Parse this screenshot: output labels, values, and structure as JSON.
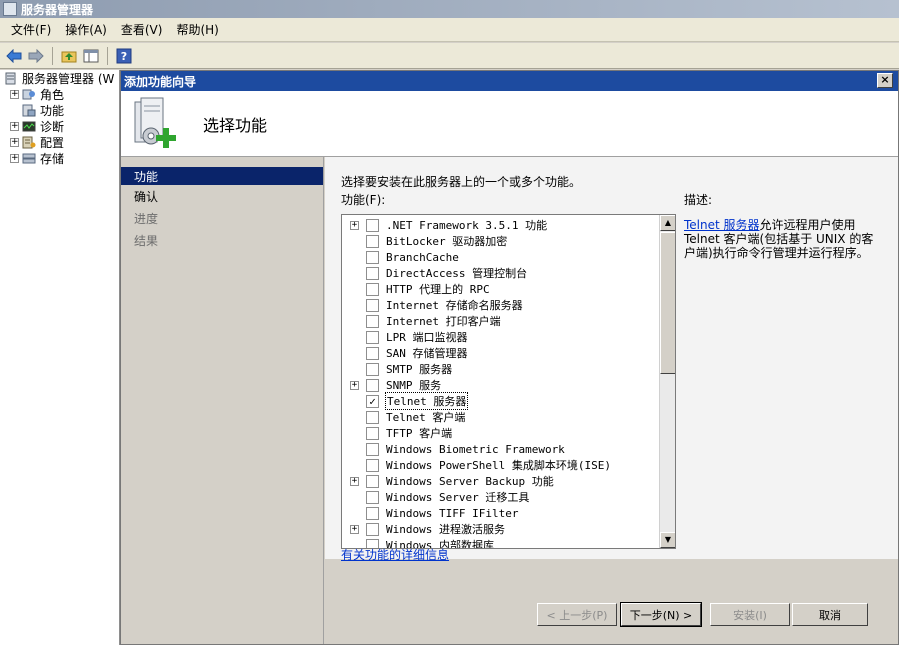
{
  "window": {
    "title": "服务器管理器"
  },
  "menu": [
    "文件(F)",
    "操作(A)",
    "查看(V)",
    "帮助(H)"
  ],
  "tree": {
    "root": "服务器管理器 (W",
    "items": [
      {
        "label": "角色",
        "expandable": true
      },
      {
        "label": "功能",
        "expandable": false
      },
      {
        "label": "诊断",
        "expandable": true
      },
      {
        "label": "配置",
        "expandable": true
      },
      {
        "label": "存储",
        "expandable": true
      }
    ]
  },
  "dialog": {
    "title": "添加功能向导",
    "close": "×",
    "header_title": "选择功能",
    "steps": [
      {
        "label": "功能",
        "state": "active"
      },
      {
        "label": "确认",
        "state": "normal"
      },
      {
        "label": "进度",
        "state": "disabled"
      },
      {
        "label": "结果",
        "state": "disabled"
      }
    ],
    "intro": "选择要安装在此服务器上的一个或多个功能。",
    "features_label": "功能(F):",
    "features": [
      {
        "label": ".NET Framework 3.5.1 功能",
        "expandable": true,
        "checked": false
      },
      {
        "label": "BitLocker 驱动器加密",
        "expandable": false,
        "checked": false
      },
      {
        "label": "BranchCache",
        "expandable": false,
        "checked": false
      },
      {
        "label": "DirectAccess 管理控制台",
        "expandable": false,
        "checked": false
      },
      {
        "label": "HTTP 代理上的 RPC",
        "expandable": false,
        "checked": false
      },
      {
        "label": "Internet 存储命名服务器",
        "expandable": false,
        "checked": false
      },
      {
        "label": "Internet 打印客户端",
        "expandable": false,
        "checked": false
      },
      {
        "label": "LPR 端口监视器",
        "expandable": false,
        "checked": false
      },
      {
        "label": "SAN 存储管理器",
        "expandable": false,
        "checked": false
      },
      {
        "label": "SMTP 服务器",
        "expandable": false,
        "checked": false
      },
      {
        "label": "SNMP 服务",
        "expandable": true,
        "checked": false
      },
      {
        "label": "Telnet 服务器",
        "expandable": false,
        "checked": true,
        "selected": true
      },
      {
        "label": "Telnet 客户端",
        "expandable": false,
        "checked": false
      },
      {
        "label": "TFTP 客户端",
        "expandable": false,
        "checked": false
      },
      {
        "label": "Windows Biometric Framework",
        "expandable": false,
        "checked": false
      },
      {
        "label": "Windows PowerShell 集成脚本环境(ISE)",
        "expandable": false,
        "checked": false
      },
      {
        "label": "Windows Server Backup 功能",
        "expandable": true,
        "checked": false
      },
      {
        "label": "Windows Server 迁移工具",
        "expandable": false,
        "checked": false
      },
      {
        "label": "Windows TIFF IFilter",
        "expandable": false,
        "checked": false
      },
      {
        "label": "Windows 进程激活服务",
        "expandable": true,
        "checked": false
      },
      {
        "label": "Windows 内部数据库",
        "expandable": false,
        "checked": false
      }
    ],
    "description_label": "描述:",
    "description_link": "Telnet 服务器",
    "description_text": "允许远程用户使用 Telnet 客户端(包括基于 UNIX 的客户端)执行命令行管理并运行程序。",
    "more_info": "有关功能的详细信息",
    "buttons": {
      "prev": "< 上一步(P)",
      "next": "下一步(N) >",
      "install": "安装(I)",
      "cancel": "取消"
    }
  }
}
